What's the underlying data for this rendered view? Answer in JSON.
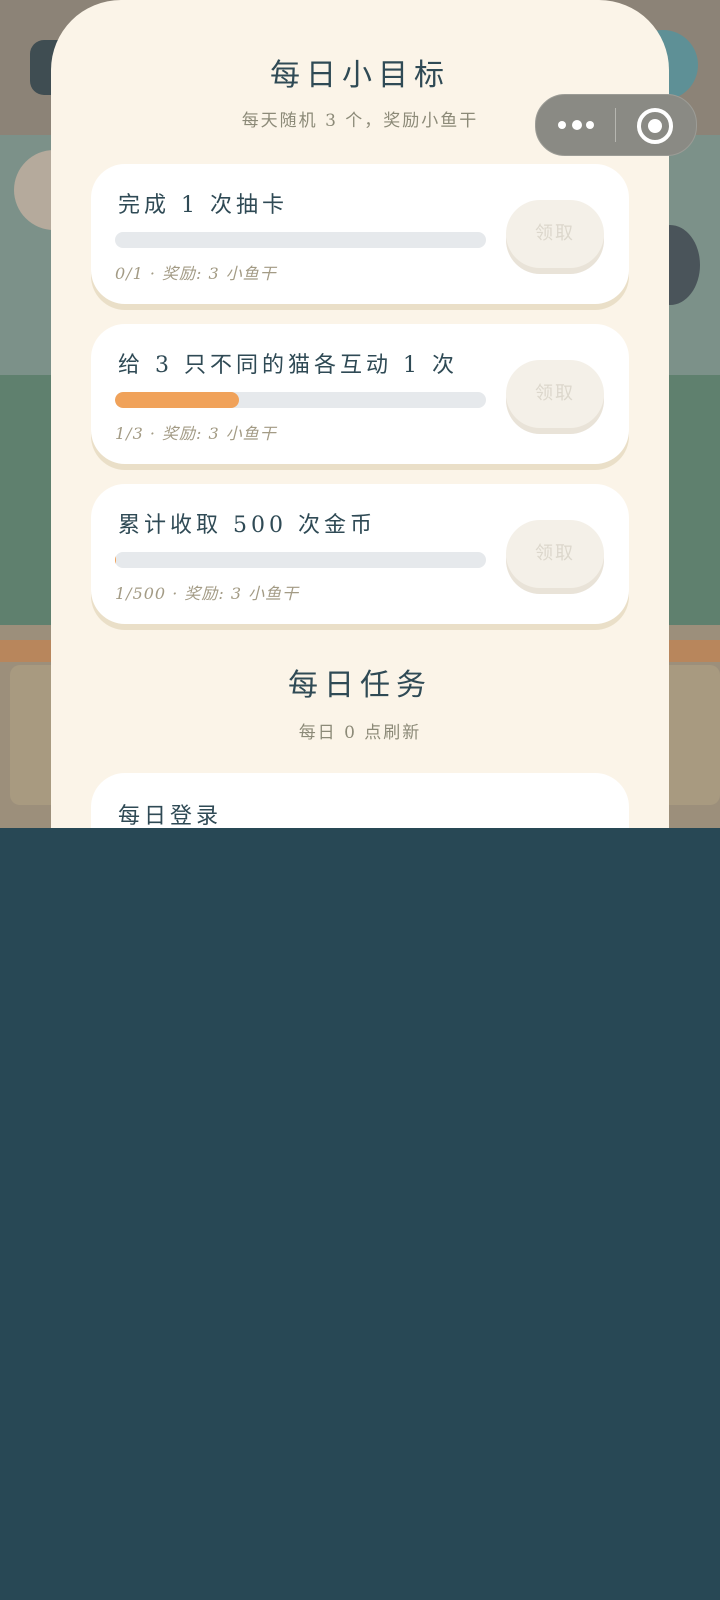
{
  "goals": {
    "title": "每日小目标",
    "subtitle": "每天随机 3 个，奖励小鱼干",
    "items": [
      {
        "title": "完成 1 次抽卡",
        "meta": "0/1 · 奖励: 3 小鱼干",
        "progress": 0.0,
        "claim_label": "领取"
      },
      {
        "title": "给 3 只不同的猫各互动 1 次",
        "meta": "1/3 · 奖励: 3 小鱼干",
        "progress": 0.333,
        "claim_label": "领取"
      },
      {
        "title": "累计收取 500 次金币",
        "meta": "1/500 · 奖励: 3 小鱼干",
        "progress": 0.002,
        "claim_label": "领取"
      }
    ]
  },
  "daily": {
    "title": "每日任务",
    "subtitle": "每日 0 点刷新",
    "items": [
      {
        "title": "每日登录"
      }
    ]
  },
  "capsule": {
    "more_icon": "more-dots-icon",
    "close_icon": "target-close-icon"
  },
  "colors": {
    "panel_bg": "#fbf4e8",
    "progress_fill": "#f0a25a",
    "progress_track": "#e6e9ec",
    "title_text": "#2f4a55",
    "page_bg": "#284855"
  }
}
